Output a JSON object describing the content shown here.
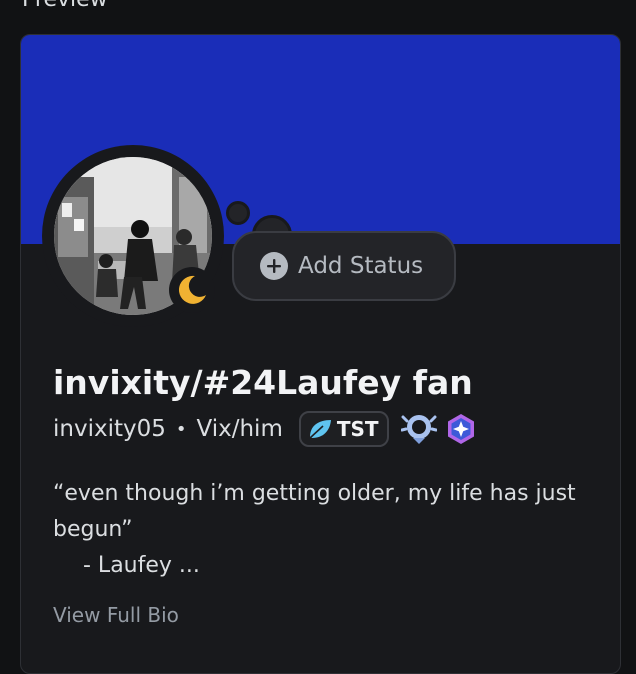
{
  "section": {
    "title": "Preview"
  },
  "colors": {
    "banner": "#1a2db8",
    "card_bg": "#18191c",
    "idle_status": "#f0b232",
    "tag_leaf": "#5fc4f0",
    "badge_wreath": "#a9c2ef",
    "badge_quest": "#b066e8"
  },
  "profile": {
    "display_name": "invixity/#24Laufey fan",
    "username": "invixity05",
    "separator": "•",
    "pronouns": "Vix/him",
    "status": "idle",
    "avatar_alt": "black-and-white photo of people in a room",
    "tag": {
      "label": "TST",
      "icon": "leaf-icon"
    },
    "badges": [
      {
        "name": "wreath-badge-icon"
      },
      {
        "name": "quest-badge-icon"
      }
    ]
  },
  "status_button": {
    "label": "Add Status",
    "icon": "plus-circle-icon"
  },
  "bio": {
    "line1": "“even though i’m getting older, my life has just begun”",
    "line2": "- Laufey ..."
  },
  "view_bio": {
    "label": "View Full Bio"
  }
}
